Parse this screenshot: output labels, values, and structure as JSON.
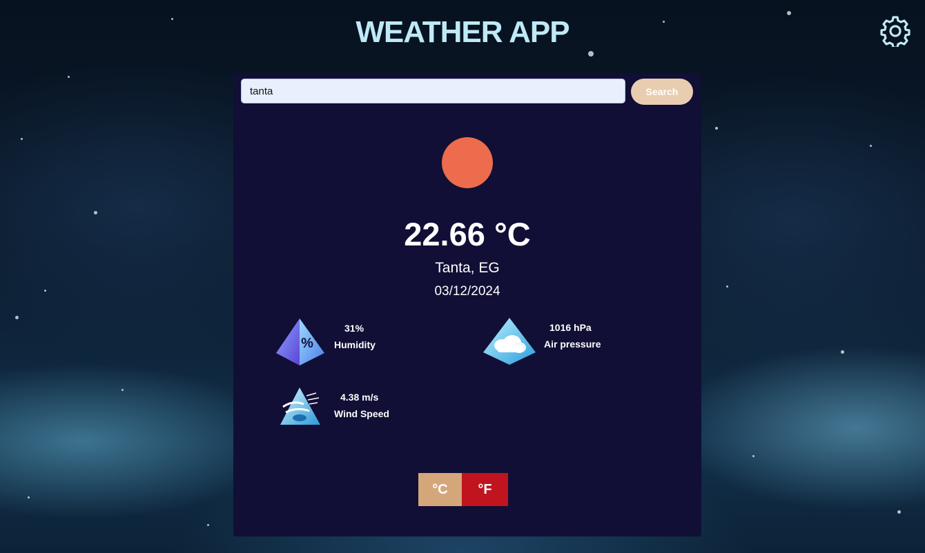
{
  "app": {
    "title": "WEATHER APP"
  },
  "search": {
    "value": "tanta",
    "button_label": "Search"
  },
  "weather": {
    "temperature": "22.66 °C",
    "location": "Tanta, EG",
    "date": "03/12/2024",
    "icon": "sun-icon"
  },
  "stats": {
    "humidity": {
      "value": "31%",
      "label": "Humidity",
      "icon": "humidity-icon"
    },
    "pressure": {
      "value": "1016 hPa",
      "label": "Air pressure",
      "icon": "cloud-pyramid-icon"
    },
    "wind": {
      "value": "4.38 m/s",
      "label": "Wind Speed",
      "icon": "wind-icon"
    }
  },
  "units": {
    "celsius_label": "°C",
    "fahrenheit_label": "°F",
    "active": "°C"
  },
  "colors": {
    "card_background": "#110f35",
    "title": "#bfe9f6",
    "search_button": "#e8cdb0",
    "sun": "#ec6c4d",
    "celsius_button": "#d4a77a",
    "fahrenheit_button": "#c0141f"
  }
}
